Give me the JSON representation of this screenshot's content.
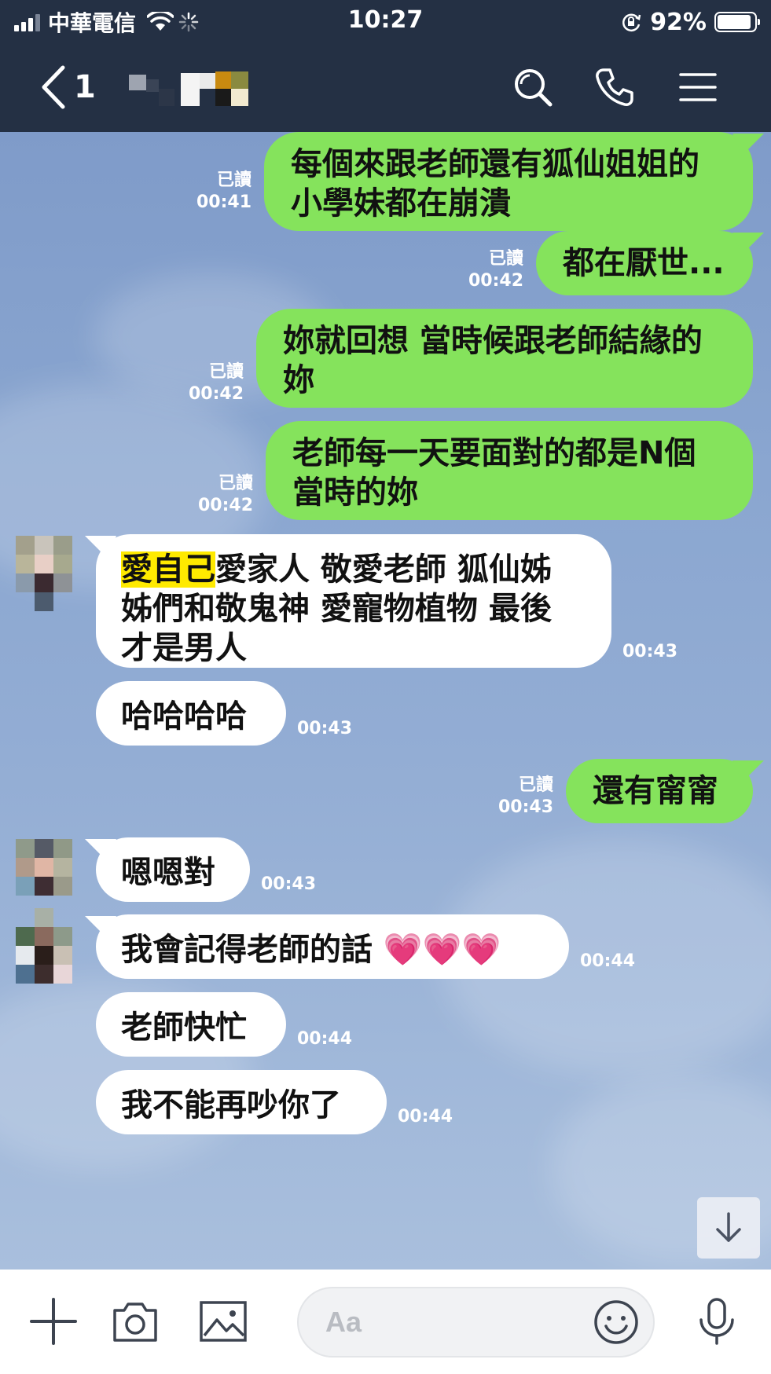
{
  "status_bar": {
    "carrier": "中華電信",
    "time": "10:27",
    "battery_percent": "92%",
    "battery_level": 0.92
  },
  "header": {
    "back_count": "1"
  },
  "messages": [
    {
      "direction": "out",
      "text_lines": [
        "每個來跟老師還有狐仙姐姐的",
        "小學妹都在崩潰"
      ],
      "read": "已讀",
      "time": "00:41"
    },
    {
      "direction": "out",
      "text_lines": [
        "都在厭世..."
      ],
      "read": "已讀",
      "time": "00:42"
    },
    {
      "direction": "out",
      "text_lines": [
        "妳就回想 當時候跟老師結緣的",
        "妳"
      ],
      "read": "已讀",
      "time": "00:42"
    },
    {
      "direction": "out",
      "text_lines": [
        "老師每一天要面對的都是N個",
        "當時的妳"
      ],
      "read": "已讀",
      "time": "00:42"
    },
    {
      "direction": "in",
      "highlight": "愛自己",
      "text_lines": [
        "愛家人 敬愛老師 狐仙姊",
        "姊們和敬鬼神  愛寵物植物 最後",
        "才是男人"
      ],
      "time": "00:43"
    },
    {
      "direction": "in",
      "text_lines": [
        "哈哈哈哈"
      ],
      "time": "00:43"
    },
    {
      "direction": "out",
      "text_lines": [
        "還有甯甯"
      ],
      "read": "已讀",
      "time": "00:43"
    },
    {
      "direction": "in",
      "text_lines": [
        "嗯嗯對"
      ],
      "time": "00:43"
    },
    {
      "direction": "in",
      "text_lines": [
        "我會記得老師的話 💗💗💗"
      ],
      "time": "00:44"
    },
    {
      "direction": "in",
      "text_lines": [
        "老師快忙"
      ],
      "time": "00:44"
    },
    {
      "direction": "in",
      "text_lines": [
        "我不能再吵你了"
      ],
      "time": "00:44"
    }
  ],
  "input": {
    "placeholder": "Aa"
  },
  "icons": {
    "back": "chevron-left-icon",
    "search": "search-icon",
    "call": "phone-icon",
    "menu": "menu-icon",
    "add": "plus-icon",
    "camera": "camera-icon",
    "image": "image-icon",
    "emoji": "emoji-icon",
    "mic": "mic-icon",
    "scroll_down": "arrow-down-icon"
  },
  "colors": {
    "header_bg": "#243044",
    "outgoing_bubble": "#85e35c",
    "incoming_bubble": "#ffffff",
    "highlight": "#ffea00"
  }
}
